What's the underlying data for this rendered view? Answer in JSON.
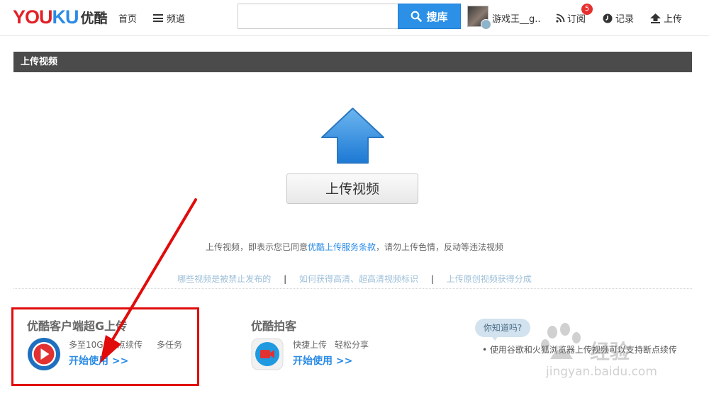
{
  "header": {
    "logo_en_red": "YOU",
    "logo_en_blue": "KU",
    "logo_cn": "优酷",
    "nav_home": "首页",
    "nav_channel": "频道",
    "search_placeholder": "",
    "search_button": "搜库",
    "username": "游戏王__g..",
    "subscribe_label": "订阅",
    "subscribe_count": "5",
    "history_label": "记录",
    "upload_label": "上传"
  },
  "section": {
    "title": "上传视频"
  },
  "upload": {
    "button_label": "上传视频",
    "notice_prefix": "上传视频，即表示您已同意",
    "notice_link": "优酷上传服务条款",
    "notice_suffix": "，请勿上传色情，反动等违法视频"
  },
  "help_links": [
    "哪些视频是被禁止发布的",
    "如何获得高清、超高清视频标识",
    "上传原创视频获得分成"
  ],
  "help_separator": "|",
  "client_block": {
    "title": "优酷客户端超G上传",
    "features": [
      "多至10G",
      "断点续传",
      "多任务"
    ],
    "start_link": "开始使用 >>"
  },
  "paike_block": {
    "title": "优酷拍客",
    "features": [
      "快捷上传",
      "轻松分享"
    ],
    "start_link": "开始使用 >>"
  },
  "tip_block": {
    "bubble": "你知道吗?",
    "text": "• 使用谷歌和火狐浏览器上传视频可以支持断点续传"
  },
  "watermark": {
    "cn": "经验",
    "en": "jingyan.baidu.com"
  },
  "colors": {
    "brand_red": "#e22027",
    "brand_blue": "#2a8be6",
    "annotation_red": "#e10b0b",
    "section_bar": "#4b4b4b"
  },
  "icons": {
    "menu": "hamburger-icon",
    "search": "search-icon",
    "rss": "rss-icon",
    "history": "clock-icon",
    "upload": "upload-arrow-icon",
    "client": "play-icon",
    "paike": "video-camera-icon"
  }
}
